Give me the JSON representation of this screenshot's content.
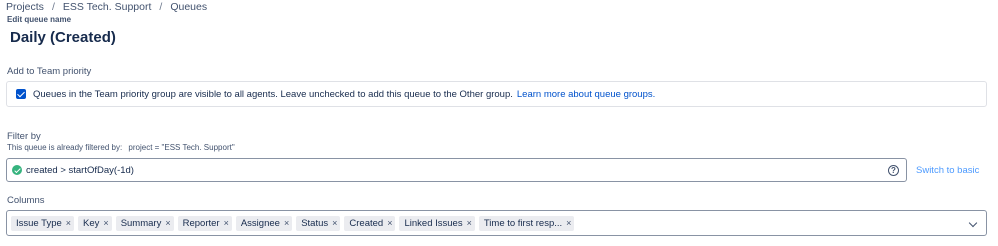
{
  "breadcrumb": {
    "items": [
      "Projects",
      "ESS Tech. Support",
      "Queues"
    ],
    "separator": "/"
  },
  "edit_label": "Edit queue name",
  "queue_name": "Daily (Created)",
  "team_priority": {
    "label": "Add to Team priority",
    "checked": true,
    "text": "Queues in the Team priority group are visible to all agents. Leave unchecked to add this queue to the Other group.",
    "link": "Learn more about queue groups."
  },
  "filter": {
    "label": "Filter by",
    "help_text": "This queue is already filtered by:",
    "help_jql": "project = \"ESS Tech. Support\"",
    "jql": "created > startOfDay(-1d)",
    "help_icon": "question-circle-icon",
    "valid_icon": "check-circle-icon",
    "switch_label": "Switch to basic"
  },
  "columns": {
    "label": "Columns",
    "items": [
      "Issue Type",
      "Key",
      "Summary",
      "Reporter",
      "Assignee",
      "Status",
      "Created",
      "Linked Issues",
      "Time to first resp..."
    ],
    "remove_glyph": "×"
  },
  "colors": {
    "accent": "#0052cc",
    "valid": "#36b37e",
    "link_light": "#4c9aff"
  }
}
